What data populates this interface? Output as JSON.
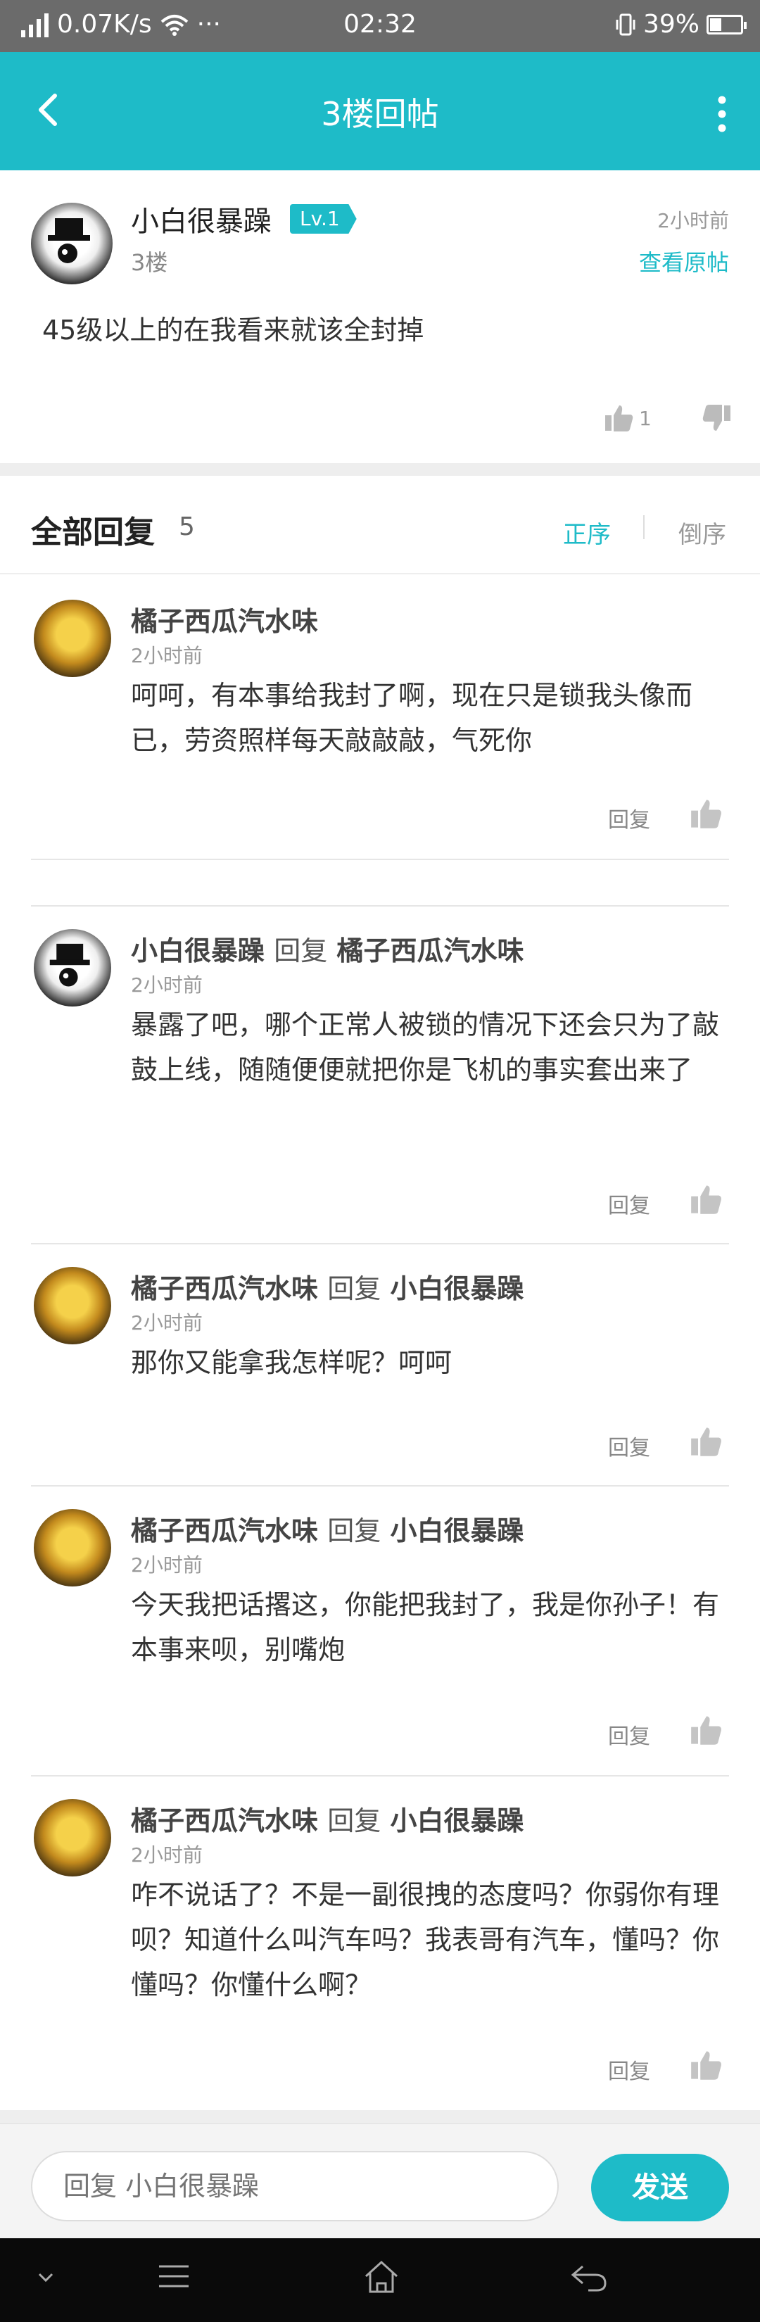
{
  "status_bar": {
    "speed": "0.07K/s",
    "more": "···",
    "time": "02:32",
    "battery": "39%",
    "battery_level": 0.39
  },
  "header": {
    "title": "3楼回帖"
  },
  "post": {
    "username": "小白很暴躁",
    "level": "Lv.1",
    "floor": "3楼",
    "time": "2小时前",
    "view_original": "查看原帖",
    "content": "45级以上的在我看来就该全封掉",
    "likes": "1"
  },
  "replies_header": {
    "label": "全部回复",
    "count": "5",
    "sort_asc": "正序",
    "sort_desc": "倒序"
  },
  "reply_label": "回复",
  "reply_verb": "回复",
  "replies": [
    {
      "author": "橘子西瓜汽水味",
      "target": "",
      "time": "2小时前",
      "content": "呵呵，有本事给我封了啊，现在只是锁我头像而已，劳资照样每天敲敲敲，气死你",
      "reply_button": "回复"
    },
    {
      "author": "小白很暴躁",
      "target": "橘子西瓜汽水味",
      "time": "2小时前",
      "content": "暴露了吧，哪个正常人被锁的情况下还会只为了敲鼓上线，随随便便就把你是飞机的事实套出来了",
      "reply_button": "回复"
    },
    {
      "author": "橘子西瓜汽水味",
      "target": "小白很暴躁",
      "time": "2小时前",
      "content": "那你又能拿我怎样呢？呵呵",
      "reply_button": "回复"
    },
    {
      "author": "橘子西瓜汽水味",
      "target": "小白很暴躁",
      "time": "2小时前",
      "content": "今天我把话撂这，你能把我封了，我是你孙子！有本事来呗，别嘴炮",
      "reply_button": "回复"
    },
    {
      "author": "橘子西瓜汽水味",
      "target": "小白很暴躁",
      "time": "2小时前",
      "content": "咋不说话了？不是一副很拽的态度吗？你弱你有理呗？知道什么叫汽车吗？我表哥有汽车，懂吗？你懂吗？你懂什么啊？",
      "reply_button": "回复"
    }
  ],
  "input": {
    "placeholder": "回复 小白很暴躁",
    "send": "发送"
  },
  "colors": {
    "accent": "#1ebbc8",
    "status_bar": "#6b6b6b",
    "nav_bar": "#0a0a0a"
  }
}
